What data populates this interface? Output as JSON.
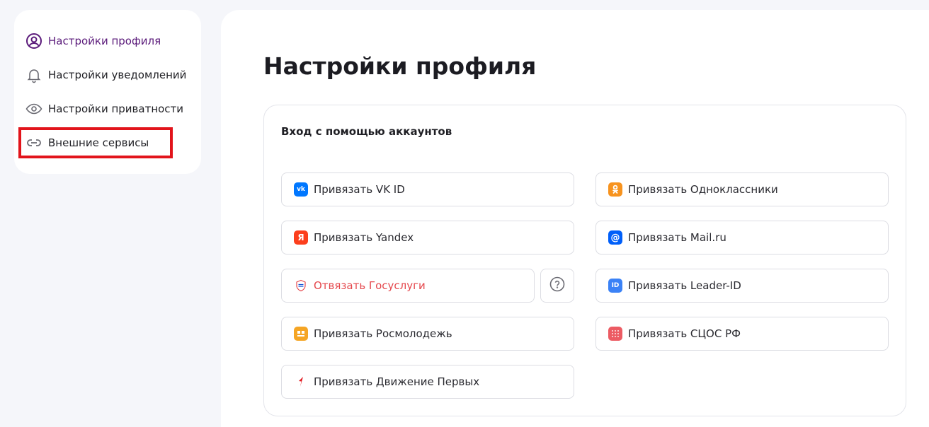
{
  "sidebar": {
    "items": [
      {
        "label": "Настройки профиля",
        "icon": "user-circle-icon",
        "active": true
      },
      {
        "label": "Настройки уведомлений",
        "icon": "bell-icon"
      },
      {
        "label": "Настройки приватности",
        "icon": "eye-icon"
      },
      {
        "label": "Внешние сервисы",
        "icon": "link-icon",
        "highlighted": true
      }
    ]
  },
  "main": {
    "title": "Настройки профиля",
    "card": {
      "title": "Вход с помощью аккаунтов",
      "buttons": [
        {
          "label": "Привязать VK ID",
          "icon": "vk-icon",
          "color": "#0077ff"
        },
        {
          "label": "Привязать Одноклассники",
          "icon": "odnoklassniki-icon",
          "color": "#f7931e"
        },
        {
          "label": "Привязать Yandex",
          "icon": "yandex-icon",
          "color": "#fc3f1d"
        },
        {
          "label": "Привязать Mail.ru",
          "icon": "mailru-icon",
          "color": "#005ff9"
        },
        {
          "label": "Отвязать Госуслуги",
          "icon": "gosuslugi-icon",
          "color": "#e5484d"
        },
        {
          "label": "Привязать Leader-ID",
          "icon": "leader-id-icon",
          "color": "#3b82f6"
        },
        {
          "label": "Привязать Росмолодежь",
          "icon": "rosmolodezh-icon",
          "color": "#f5a524"
        },
        {
          "label": "Привязать СЦОС РФ",
          "icon": "scos-icon",
          "color": "#ec5b63"
        },
        {
          "label": "Привязать Движение Первых",
          "icon": "dvizhenie-pervykh-icon",
          "color": "#e2141b"
        }
      ]
    }
  },
  "colors": {
    "accent": "#5a1a7a",
    "danger": "#e5484d",
    "highlight": "#e2141b",
    "background": "#f5f6fa"
  }
}
